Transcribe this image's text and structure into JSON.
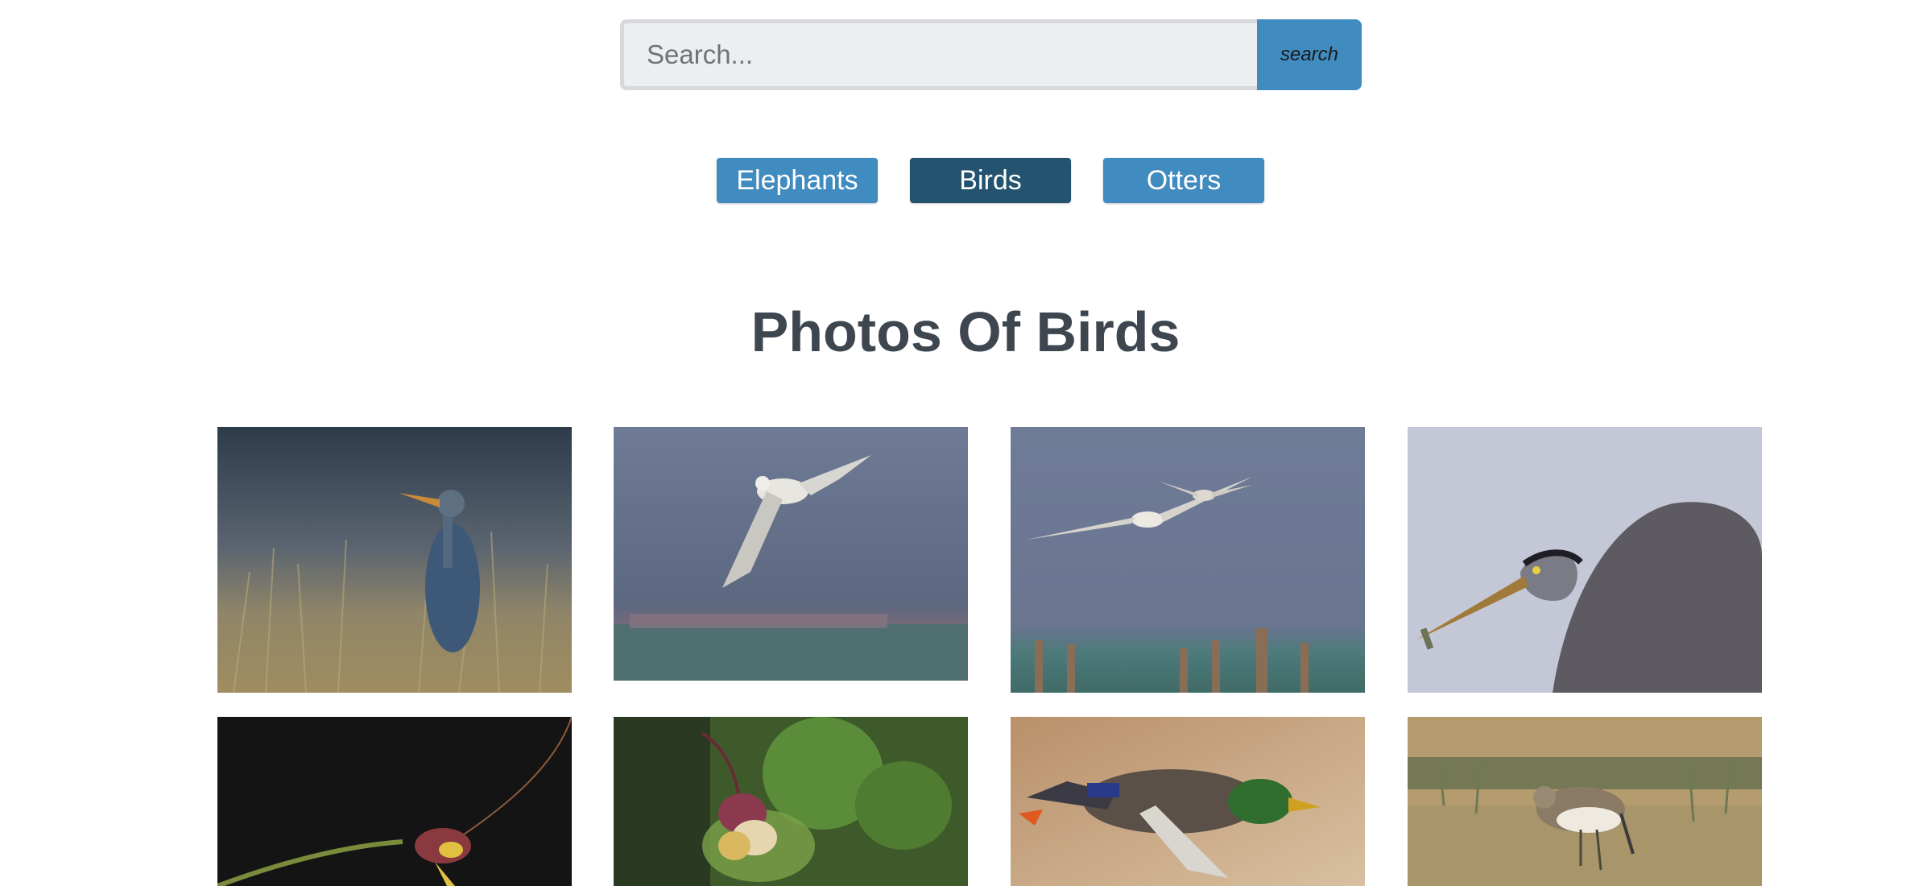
{
  "search": {
    "placeholder": "Search...",
    "button_label": "search"
  },
  "categories": [
    {
      "label": "Elephants",
      "active": false
    },
    {
      "label": "Birds",
      "active": true
    },
    {
      "label": "Otters",
      "active": false
    }
  ],
  "gallery": {
    "title": "Photos Of Birds",
    "photos": [
      {
        "subject": "great blue heron standing in dry grass"
      },
      {
        "subject": "gull in flight against blue sky"
      },
      {
        "subject": "two gulls flying over water with pilings"
      },
      {
        "subject": "heron close-up holding small fish"
      },
      {
        "subject": "hummingbird-like bird on branch, dark background"
      },
      {
        "subject": "orchid flower with green leaves"
      },
      {
        "subject": "mallard duck in flight"
      },
      {
        "subject": "sandpiper wading in shallow water"
      }
    ]
  },
  "colors": {
    "button_blue": "#408bbf",
    "button_active": "#23536f",
    "title_text": "#3e4650"
  }
}
